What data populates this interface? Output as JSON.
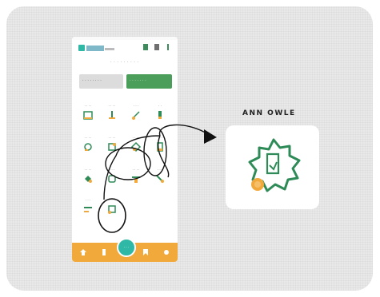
{
  "callout": {
    "title": "ANN OWLE"
  },
  "app": {
    "subtitle": "· · · · · · · · ·",
    "banners": [
      {
        "label": "· · · · · · · ·"
      },
      {
        "label": "· · · · · · ·"
      }
    ],
    "grid": [
      {
        "label": "· · · ·"
      },
      {
        "label": "· · · ·"
      },
      {
        "label": "· · ·"
      },
      {
        "label": "· ·"
      },
      {
        "label": "· · · ·"
      },
      {
        "label": "· · · ·"
      },
      {
        "label": "· · · ·"
      },
      {
        "label": "· · ·"
      },
      {
        "label": "· · · ·"
      },
      {
        "label": "· · ·"
      },
      {
        "label": "· · · ·"
      },
      {
        "label": "· · ·"
      },
      {
        "label": "· · ·"
      },
      {
        "label": "· · ·"
      }
    ],
    "fab_label": "· · ·"
  },
  "colors": {
    "accent_green": "#2e8b57",
    "accent_orange": "#f2a93b",
    "fab_teal": "#2fb8a6"
  }
}
